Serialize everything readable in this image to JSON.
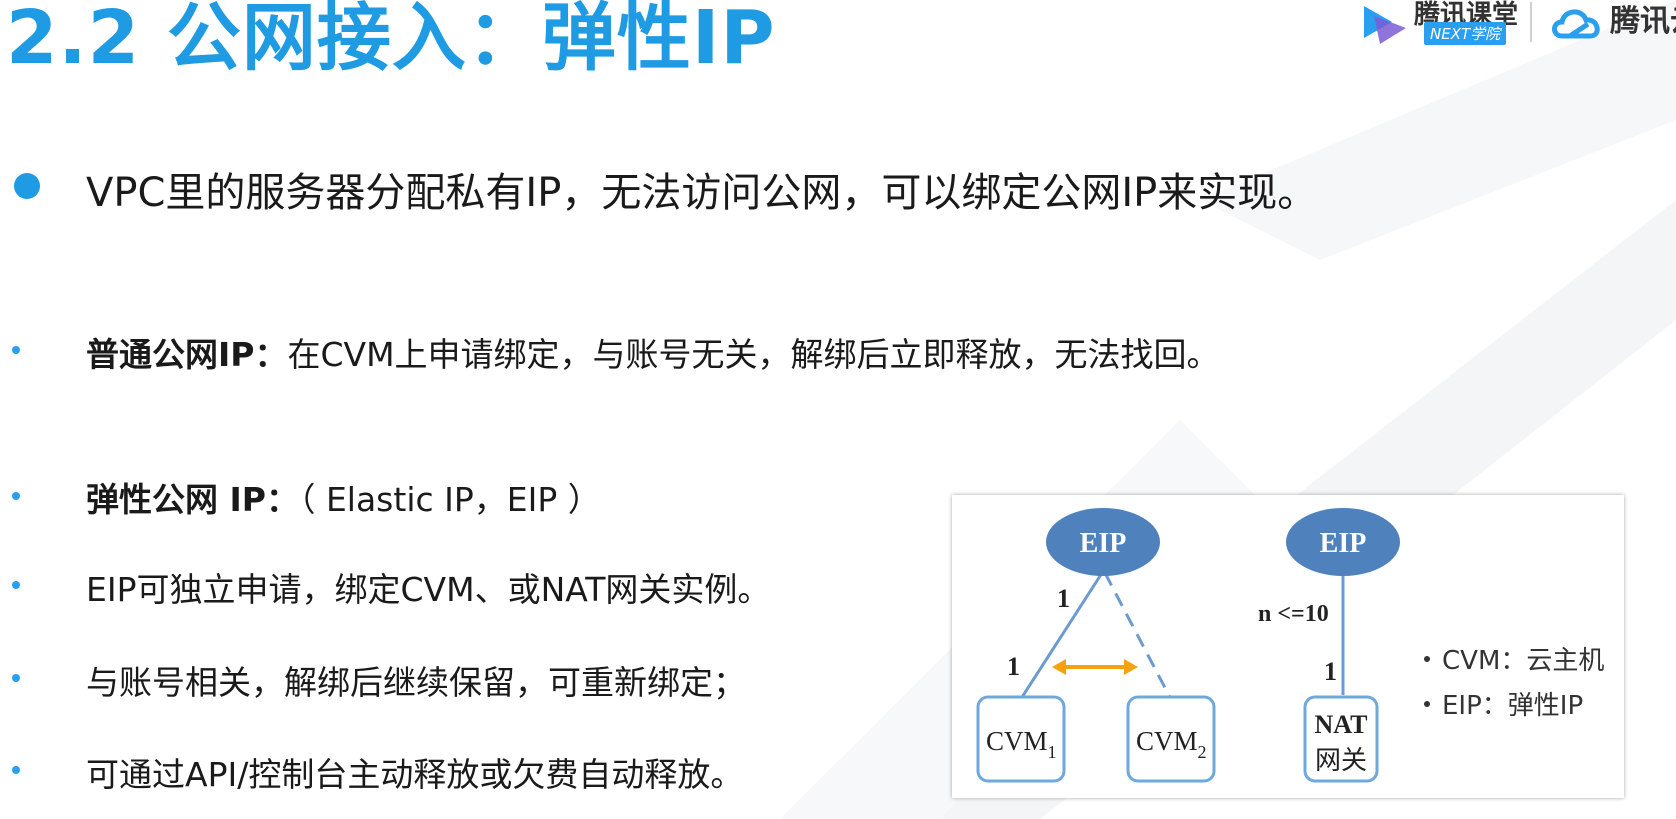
{
  "title": "2.2 公网接入：弹性IP",
  "logos": {
    "classroom_name": "腾讯课堂",
    "classroom_badge": "NEXT学院",
    "cloud_name": "腾讯云"
  },
  "main_bullet": "VPC里的服务器分配私有IP，无法访问公网，可以绑定公网IP来实现。",
  "sub_bullets": [
    {
      "bold": "普通公网IP：",
      "text": "在CVM上申请绑定，与账号无关，解绑后立即释放，无法找回。"
    },
    {
      "bold": "弹性公网 IP：",
      "text": "（ Elastic IP，EIP ）"
    },
    {
      "bold": "",
      "text": "EIP可独立申请，绑定CVM、或NAT网关实例。"
    },
    {
      "bold": "",
      "text": "与账号相关，解绑后继续保留，可重新绑定；"
    },
    {
      "bold": "",
      "text": "可通过API/控制台主动释放或欠费自动释放。"
    }
  ],
  "diagram": {
    "left_eip": "EIP",
    "right_eip": "EIP",
    "label_1_top": "1",
    "label_1_bottom": "1",
    "label_n": "n <=10",
    "label_1_nat": "1",
    "cvm1_main": "CVM",
    "cvm1_sub": "1",
    "cvm2_main": "CVM",
    "cvm2_sub": "2",
    "nat_line1": "NAT",
    "nat_line2": "网关",
    "legend": [
      "CVM：云主机",
      "EIP：弹性IP"
    ],
    "colors": {
      "ellipse": "#4f81bd",
      "box_border": "#6fa8dc",
      "arrow": "#f4a30e",
      "line": "#6b9bd1"
    }
  },
  "colors": {
    "title": "#1f9be3",
    "bullet": "#2a9ff0"
  }
}
